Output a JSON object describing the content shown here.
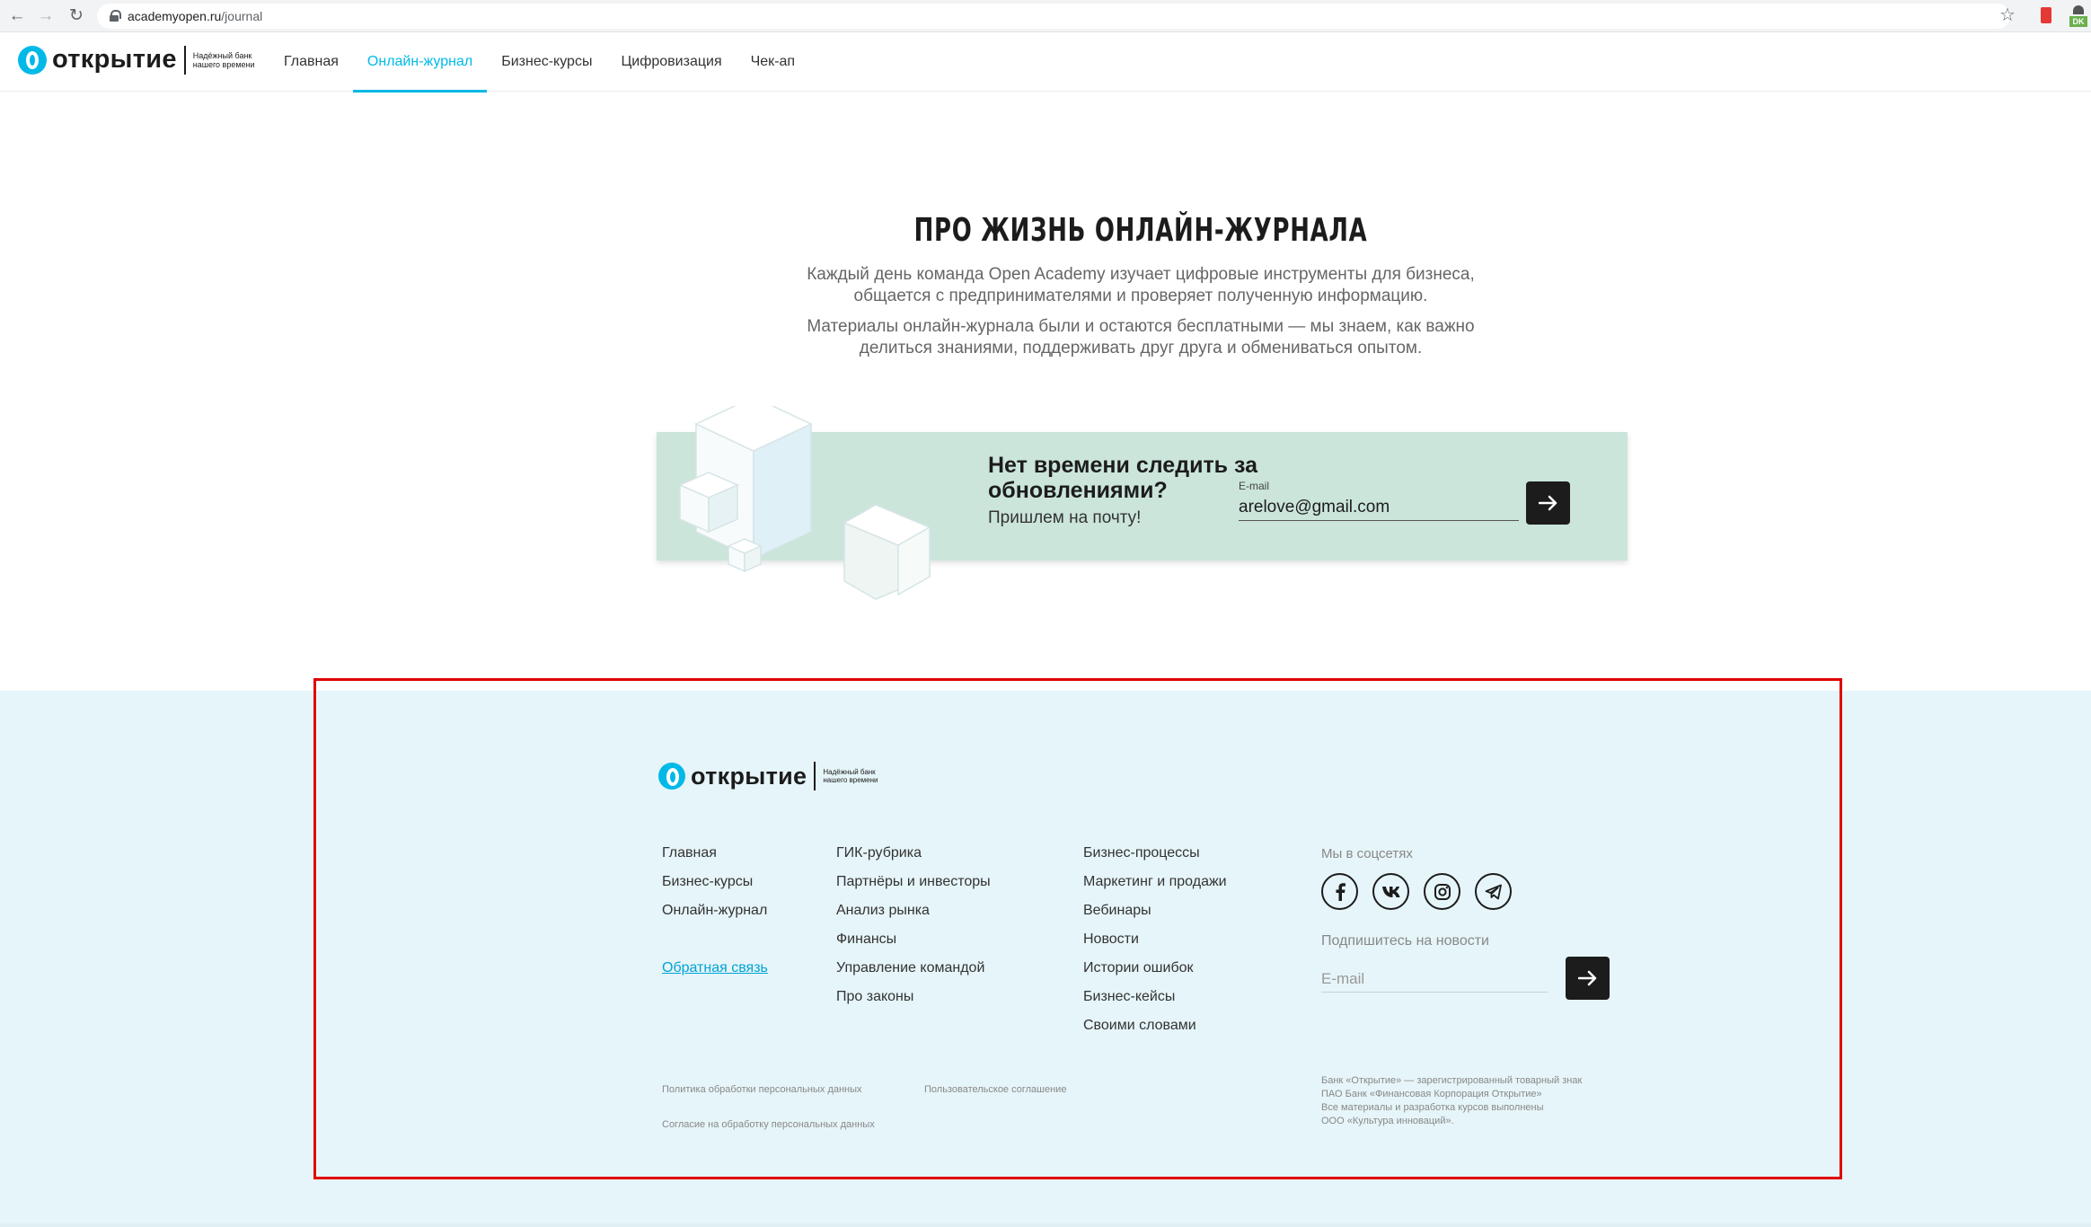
{
  "browser": {
    "url_domain": "academyopen.ru",
    "url_path": "/journal",
    "ext_badge": "DK"
  },
  "header": {
    "logo_word": "открытие",
    "logo_tagline": "Надёжный банк нашего времени",
    "nav": [
      {
        "label": "Главная"
      },
      {
        "label": "Онлайн-журнал"
      },
      {
        "label": "Бизнес-курсы"
      },
      {
        "label": "Цифровизация"
      },
      {
        "label": "Чек-ап"
      }
    ],
    "active_index": 1
  },
  "hero": {
    "title": "ПРО ЖИЗНЬ ОНЛАЙН-ЖУРНАЛА",
    "paragraph1": "Каждый день команда Open Academy изучает цифровые инструменты для бизнеса, общается с предпринимателями и проверяет полученную информацию.",
    "paragraph2": "Материалы онлайн-журнала были и остаются бесплатными — мы знаем, как важно делиться знаниями, поддерживать друг друга и обмениваться опытом."
  },
  "subscribe": {
    "title": "Нет времени следить за обновлениями?",
    "subtitle": "Пришлем на почту!",
    "email_label": "E-mail",
    "email_value": "arelove@gmail.com"
  },
  "footer": {
    "logo_word": "открытие",
    "logo_tagline": "Надёжный банк нашего времени",
    "col1": [
      "Главная",
      "Бизнес-курсы",
      "Онлайн-журнал"
    ],
    "feedback": "Обратная связь",
    "col2": [
      "ГИК-рубрика",
      "Партнёры и инвесторы",
      "Анализ рынка",
      "Финансы",
      "Управление командой",
      "Про законы"
    ],
    "col3": [
      "Бизнес-процессы",
      "Маркетинг и продажи",
      "Вебинары",
      "Новости",
      "Истории ошибок",
      "Бизнес-кейсы",
      "Своими словами"
    ],
    "social_label": "Мы в соцсетях",
    "social_icons": [
      "facebook-icon",
      "vk-icon",
      "instagram-icon",
      "telegram-icon"
    ],
    "news_label": "Подпишитесь на новости",
    "email_placeholder": "E-mail",
    "legal": {
      "privacy": "Политика обработки персональных данных",
      "agreement": "Пользовательское соглашение",
      "consent": "Согласие на обработку персональных данных"
    },
    "copyright": [
      "Банк «Открытие» — зарегистрированный товарный знак",
      "ПАО Банк «Финансовая Корпорация Открытие»",
      "Все материалы и разработка курсов выполнены",
      "ООО «Культура инноваций»."
    ]
  },
  "colors": {
    "accent": "#00b9e7",
    "banner_bg": "#cbe5db",
    "footer_bg": "#e6f5f9",
    "annotation": "#e00000",
    "button_dark": "#1c1c1c"
  }
}
